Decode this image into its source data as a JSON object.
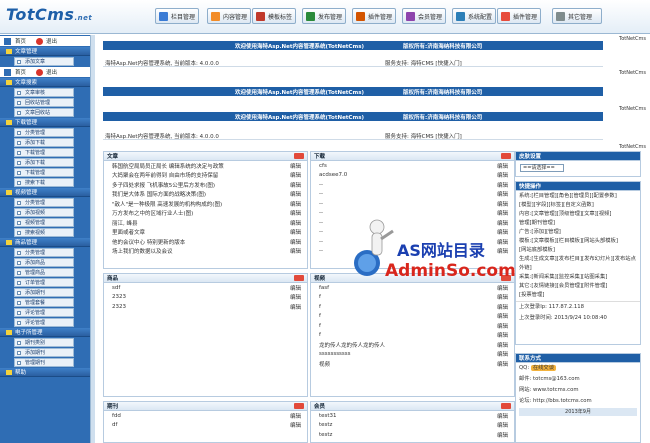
{
  "logo": {
    "main": "TotCms",
    "suffix": ".net"
  },
  "topnav": [
    {
      "label": "栏目管理",
      "color": "#3a7bd5"
    },
    {
      "label": "内容管理",
      "color": "#f28c28"
    },
    {
      "label": "模板标签",
      "color": "#c0392b"
    },
    {
      "label": "发布管理",
      "color": "#2a8a3a"
    },
    {
      "label": "插件管理",
      "color": "#d35400"
    },
    {
      "label": "会员管理",
      "color": "#8e44ad"
    },
    {
      "label": "系统配置",
      "color": "#2c7fb8"
    },
    {
      "label": "插件管理",
      "color": "#e74c3c"
    },
    {
      "label": "其它管理",
      "color": "#7f8c8d"
    }
  ],
  "sidebar": {
    "home": "首页",
    "exit": "退出",
    "groups": [
      {
        "title": "文章管理",
        "items": [
          "添加文章"
        ]
      },
      {
        "title": "文章搜索",
        "items": [
          "文章审核",
          "回收站管理",
          "文章回收站"
        ]
      },
      {
        "title": "下载管理",
        "items": [
          "分类管理",
          "添加下载",
          "下载管理",
          "添加下载",
          "下载管理",
          "搜索下载"
        ]
      },
      {
        "title": "视频管理",
        "items": [
          "分类管理",
          "添加视频",
          "视频管理",
          "搜索视频"
        ]
      },
      {
        "title": "商品管理",
        "items": [
          "分类管理",
          "添加商品",
          "管理商品",
          "订单管理",
          "添加期刊",
          "管理套餐",
          "评论管理",
          "评论管理"
        ]
      },
      {
        "title": "电子所管理",
        "items": [
          "期刊类别",
          "添加期刊",
          "管理期刊"
        ]
      },
      {
        "title": "帮助",
        "items": []
      }
    ]
  },
  "main": {
    "site_label": "TotNetCms",
    "banner": "欢迎使用海特Asp.Net内容管理系统(TotNetCms) 版权所有:济南海纳科技有限公司",
    "banner_left": "欢迎使用海特Asp.Net内容管理系统(TotNetCms)",
    "banner_right": "版权所有:济南海纳科技有限公司",
    "version": "海特Asp.Net内容管理系统, 当前版本: 4.0.0.0",
    "service": "服务支持: 海特CMS [快捷入门]",
    "version2": "海特Asp.Net内容管理系统, 当前版本: 4.0.0.0",
    "service2": "服务支持: 海特CMS [快捷入门]",
    "panels": {
      "article": {
        "title": "文章",
        "edit": "编辑",
        "items": [
          "韩国航空局局员正局长 编辑系统的决定与政策",
          "大妈聚会在两年前得到 自由市场的支持保留",
          "多子四处求报 飞机事故5公里后方发布(图)",
          "我们是大体系 国际方面的战略决策(图)",
          "\"敌人\"是一种极限 高速发展的机构构成的(图)",
          "万方发布之中的区域行业人士(图)",
          "丽江, 峰县",
          "里面或者文章",
          "他的会议中心 特别更新的版本",
          "场上我们的数据以及会议"
        ]
      },
      "download": {
        "title": "下载",
        "edit": "编辑",
        "items": [
          "cfs",
          "acdsee7.0",
          "--",
          "--",
          "--",
          "--",
          "--",
          "--",
          "--",
          "--"
        ]
      },
      "goods": {
        "title": "商品",
        "edit": "编辑",
        "items": [
          "sdf",
          "2323",
          "2323"
        ]
      },
      "video": {
        "title": "视频",
        "edit": "编辑",
        "items": [
          "fasf",
          "f",
          "f",
          "f",
          "f",
          "f",
          "龙的传人龙的传人龙的传人",
          "sssssssssss",
          "视频"
        ]
      },
      "journal": {
        "title": "期刊",
        "edit": "编辑",
        "items": [
          "fdd",
          "df"
        ]
      },
      "member": {
        "title": "会员",
        "edit": "编辑",
        "items": [
          "test31",
          "testz",
          "testz"
        ]
      }
    },
    "right": {
      "theme_title": "皮肤设置",
      "theme_value": "==请选择==",
      "quick_title": "快捷操作",
      "quick_text": [
        "系统:[栏目管理][角色][管理员][配置参数]",
        "[模型][字段][标签][自定义函数]",
        "内容:[文章管理][顶级管理][文章][视频]",
        "管理[期刊管理]",
        "广告:[添加][管理]",
        "模板:[文章模板][栏目模板][网站头部模板]",
        "[网站底部模板]",
        "生成:[生成文章][发布栏目][发布幻灯片][发布站点外链]",
        "采集:[新闻采集][监控采集][站图采集]",
        "其它:[友情链接][会员管理][附件管理]",
        "[投票管理]"
      ],
      "last_ip": "上次登录Ip: 117.87.2.118",
      "last_time": "上次登录时间: 2013/9/24 10:08:40",
      "contact_title": "联系方式",
      "contact_qq": "QQ:",
      "qq_btn": "在线交谈",
      "email": "邮件: totcms@163.com",
      "site": "网站: www.totcms.com",
      "forum": "论坛: http://bbs.totcms.com",
      "calendar": "2013年9月"
    }
  },
  "watermark": {
    "title": "AS网站目录",
    "sub": "AdminSo.com"
  }
}
